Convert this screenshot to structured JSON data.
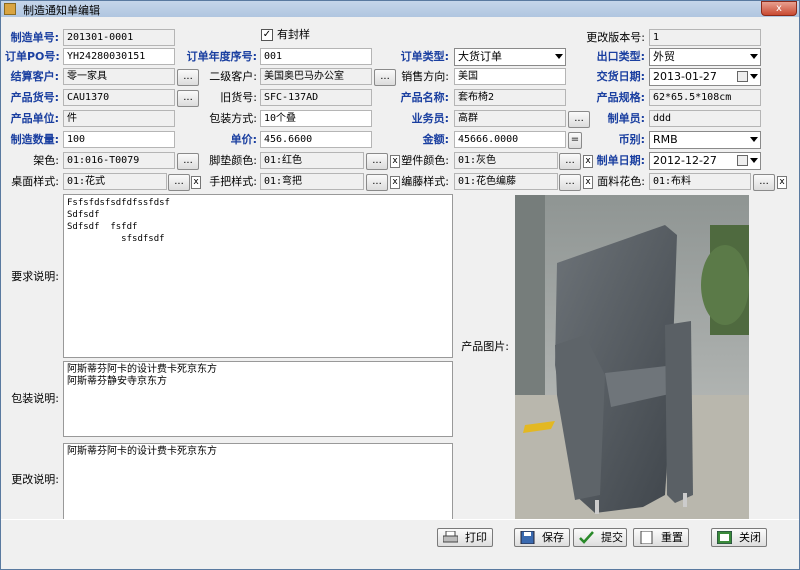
{
  "window": {
    "title": "制造通知单编辑",
    "close_label": "x"
  },
  "fields": {
    "manufacture_no_label": "制造单号:",
    "manufacture_no": "201301-0001",
    "sealed_sample_label": "有封样",
    "revision_label": "更改版本号:",
    "revision": "1",
    "order_po_label": "订单PO号:",
    "order_po": "YH24280030151",
    "order_year_seq_label": "订单年度序号:",
    "order_year_seq": "001",
    "order_type_label": "订单类型:",
    "order_type": "大货订单",
    "export_type_label": "出口类型:",
    "export_type": "外贸",
    "settle_customer_label": "结算客户:",
    "settle_customer": "零一家具",
    "sub_customer_label": "二级客户:",
    "sub_customer": "美国奥巴马办公室",
    "sales_direction_label": "销售方向:",
    "sales_direction": "美国",
    "delivery_date_label": "交货日期:",
    "delivery_date": "2013-01-27",
    "product_no_label": "产品货号:",
    "product_no": "CAU1370",
    "old_no_label": "旧货号:",
    "old_no": "SFC-137AD",
    "product_name_label": "产品名称:",
    "product_name": "套布椅2",
    "product_spec_label": "产品规格:",
    "product_spec": "62*65.5*108cm",
    "product_unit_label": "产品单位:",
    "product_unit": "件",
    "packing_label": "包装方式:",
    "packing": "10个叠",
    "salesperson_label": "业务员:",
    "salesperson": "高群",
    "creator_label": "制单员:",
    "creator": "ddd",
    "quantity_label": "制造数量:",
    "quantity": "100",
    "unit_price_label": "单价:",
    "unit_price": "456.6600",
    "amount_label": "金额:",
    "amount": "45666.0000",
    "currency_label": "币别:",
    "currency": "RMB",
    "frame_color_label": "架色:",
    "frame_color": "01:016-T0079",
    "foot_pad_color_label": "脚垫颜色:",
    "foot_pad_color": "01:红色",
    "plastic_color_label": "塑件颜色:",
    "plastic_color": "01:灰色",
    "create_date_label": "制单日期:",
    "create_date": "2012-12-27",
    "table_style_label": "桌面样式:",
    "table_style": "01:花式",
    "handle_style_label": "手把样式:",
    "handle_style": "01:弯把",
    "weave_style_label": "编藤样式:",
    "weave_style": "01:花色编藤",
    "fabric_pattern_label": "面料花色:",
    "fabric_pattern": "01:布料",
    "requirements_label": "要求说明:",
    "requirements": "Fsfsfdsfsdfdfssfdsf\nSdfsdf\nSdfsdf  fsfdf\n          sfsdfsdf",
    "packing_desc_label": "包装说明:",
    "packing_desc": "阿斯蒂芬阿卡的设计费卡死京东方\n阿斯蒂芬静安寺京东方",
    "change_desc_label": "更改说明:",
    "change_desc": "阿斯蒂芬阿卡的设计费卡死京东方",
    "product_image_label": "产品图片:",
    "lookup_button": "...",
    "clear_button": "x",
    "equals_button": "="
  },
  "actions": {
    "print": "打印",
    "save": "保存",
    "submit": "提交",
    "reset": "重置",
    "close": "关闭"
  },
  "colors": {
    "label_blue": "#1a3fa0",
    "window_bg": "#f0f0f0"
  }
}
